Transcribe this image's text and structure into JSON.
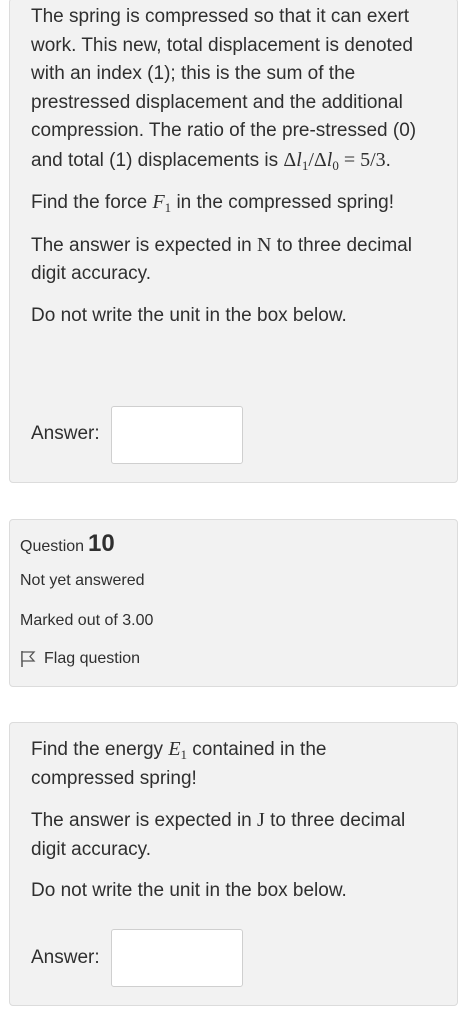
{
  "prev_question": {
    "paragraphs": {
      "p1_start": "The spring is compressed so that it can exert work. This new, total displacement is denoted with an index (1); this is the sum of the prestressed displacement and the additional compression. The ratio of the pre-stressed (0) and total (1) displacements is ",
      "p1_math": "Δl₁/Δl₀ = 5/3",
      "p1_end": ".",
      "p2_start": "Find the force ",
      "p2_symbol": "F",
      "p2_sub": "1",
      "p2_end": " in the compressed spring!",
      "p3_start": "The answer is expected in ",
      "p3_unit": "N",
      "p3_end": " to three decimal digit accuracy.",
      "p4": "Do not write the unit in the box below."
    },
    "answer_label": "Answer:",
    "answer_value": ""
  },
  "question_info": {
    "question_label": "Question",
    "question_number": "10",
    "status": "Not yet answered",
    "marks": "Marked out of 3.00",
    "flag_label": "Flag question"
  },
  "question10": {
    "p1_start": "Find the energy ",
    "p1_symbol": "E",
    "p1_sub": "1",
    "p1_end": " contained in the compressed spring!",
    "p2_start": "The answer is expected in ",
    "p2_unit": "J",
    "p2_end": " to three decimal digit accuracy.",
    "p3": "Do not write the unit in the box below.",
    "answer_label": "Answer:",
    "answer_value": ""
  }
}
